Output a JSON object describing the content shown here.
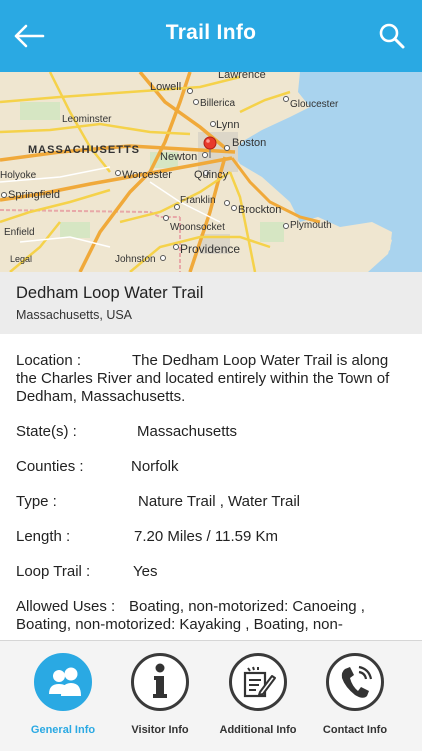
{
  "colors": {
    "header": "#2aa9e3",
    "accent": "#2aa9e3",
    "text": "#222222"
  },
  "header": {
    "title": "Trail Info",
    "back_icon": "arrow-left-icon",
    "search_icon": "search-icon"
  },
  "map": {
    "labels": {
      "lawrence": "Lawrence",
      "lowell": "Lowell",
      "billerica": "Billerica",
      "gloucester": "Gloucester",
      "leominster": "Leominster",
      "lynn": "Lynn",
      "massachusetts": "MASSACHUSETTS",
      "boston": "Boston",
      "newton": "Newton",
      "holyoke": "Holyoke",
      "worcester": "Worcester",
      "quincy": "Quincy",
      "springfield": "Springfield",
      "franklin": "Franklin",
      "brockton": "Brockton",
      "enfield": "Enfield",
      "woonsocket": "Woonsocket",
      "plymouth": "Plymouth",
      "providence": "Providence",
      "johnston": "Johnston",
      "legal": "Legal"
    }
  },
  "trail": {
    "name": "Dedham Loop Water Trail",
    "location": "Massachusetts, USA"
  },
  "details": {
    "location_label": "Location  :",
    "location_line1": "The Dedham Loop Water Trail is along",
    "location_line2": "the Charles River and located entirely within the Town of",
    "location_line3": "Dedham, Massachusetts.",
    "state_label": "State(s)  :",
    "state_value": "Massachusetts",
    "counties_label": "Counties  :",
    "counties_value": "Norfolk",
    "type_label": "Type  :",
    "type_value": "Nature Trail , Water Trail",
    "length_label": "Length  :",
    "length_value": "7.20 Miles / 11.59 Km",
    "loop_label": "Loop Trail  :",
    "loop_value": "Yes",
    "uses_label": "Allowed Uses  :",
    "uses_line1": "Boating, non-motorized: Canoeing ,",
    "uses_line2": "Boating, non-motorized: Kayaking , Boating, non-"
  },
  "tabs": [
    {
      "label": "General Info",
      "icon": "users-icon",
      "active": true
    },
    {
      "label": "Visitor Info",
      "icon": "info-icon",
      "active": false
    },
    {
      "label": "Additional Info",
      "icon": "edit-note-icon",
      "active": false
    },
    {
      "label": "Contact Info",
      "icon": "phone-icon",
      "active": false
    }
  ]
}
